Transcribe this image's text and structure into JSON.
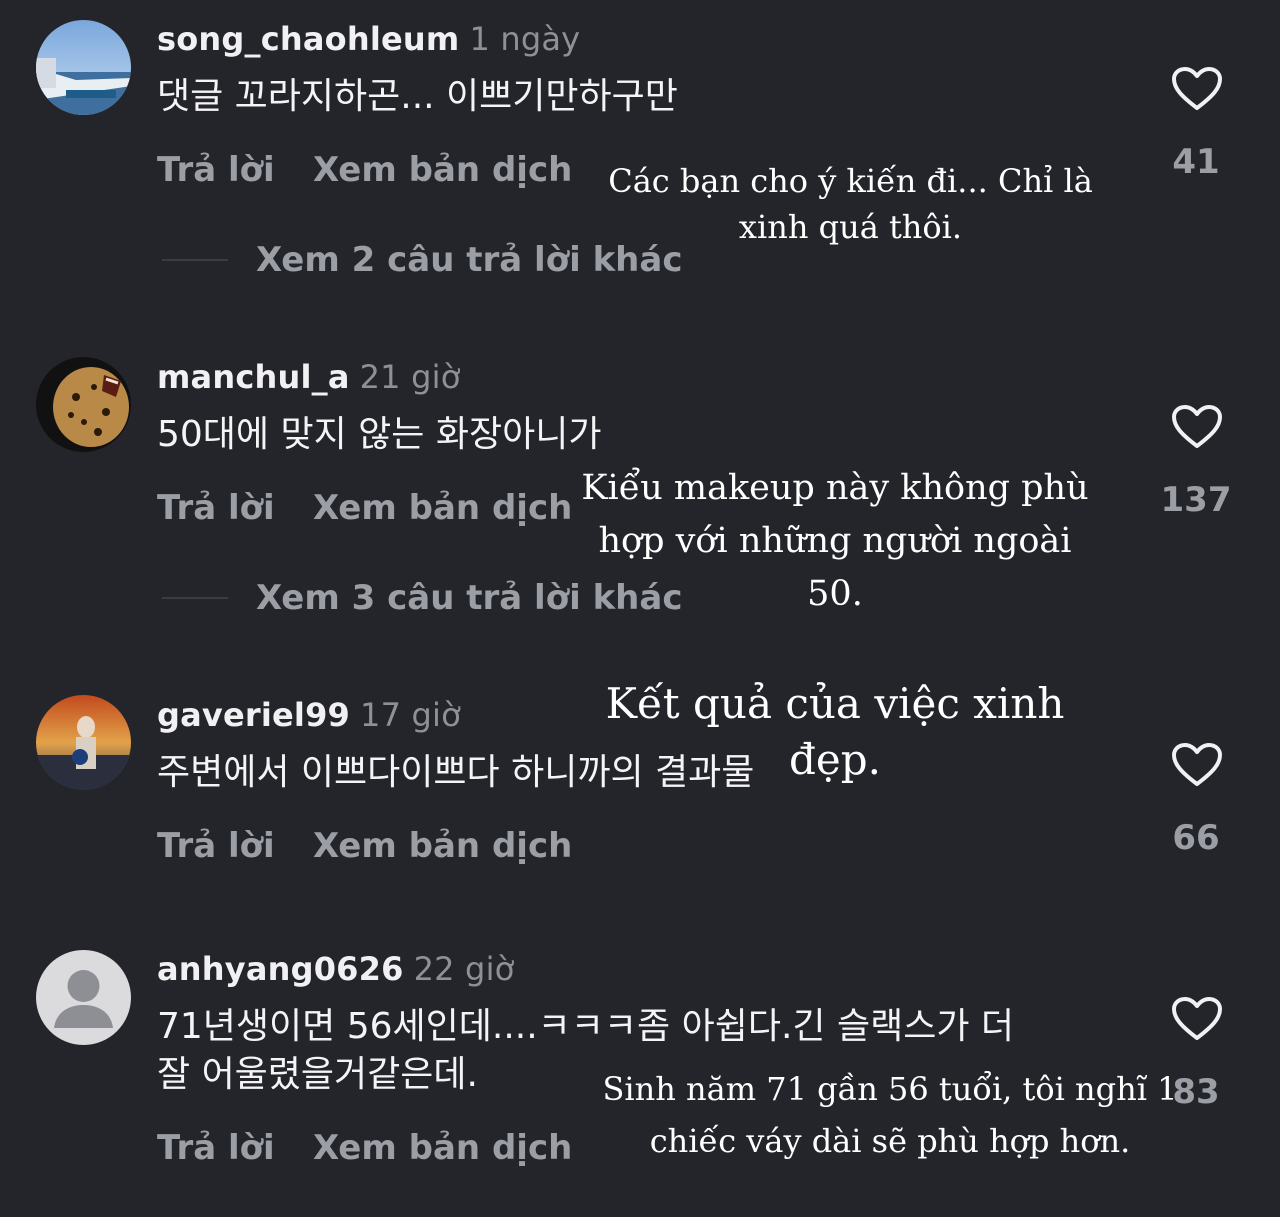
{
  "comments": [
    {
      "username": "song_chaohleum",
      "time": "1 ngày",
      "text": "댓글 꼬라지하곤... 이쁘기만하구만",
      "reply_label": "Trả lời",
      "translate_label": "Xem bản dịch",
      "more_replies": "Xem 2 câu trả lời khác",
      "likes": "41",
      "overlay": "Các bạn cho ý kiến đi... Chỉ là xinh quá thôi."
    },
    {
      "username": "manchul_a",
      "time": "21 giờ",
      "text": "50대에 맞지 않는 화장아니가",
      "reply_label": "Trả lời",
      "translate_label": "Xem bản dịch",
      "more_replies": "Xem 3 câu trả lời khác",
      "likes": "137",
      "overlay": "Kiểu makeup này không phù hợp với những người ngoài 50."
    },
    {
      "username": "gaveriel99",
      "time": "17 giờ",
      "text": "주변에서 이쁘다이쁘다 하니까의 결과물",
      "reply_label": "Trả lời",
      "translate_label": "Xem bản dịch",
      "likes": "66",
      "overlay": "Kết quả của việc xinh đẹp."
    },
    {
      "username": "anhyang0626",
      "time": "22 giờ",
      "text_line1": "71년생이면 56세인데....ㅋㅋㅋ좀 아쉽다.긴 슬랙스가 더",
      "text_line2": "잘 어울렸을거같은데.",
      "reply_label": "Trả lời",
      "translate_label": "Xem bản dịch",
      "likes": "83",
      "overlay": "Sinh năm 71 gần 56 tuổi, tôi nghĩ 1 chiếc váy dài sẽ phù hợp hơn."
    }
  ],
  "colors": {
    "background": "#23252b",
    "primary_text": "#f4f4f6",
    "secondary_text": "#9c9ea5"
  },
  "icons": {
    "like": "heart-outline-icon",
    "default_avatar": "person-silhouette-icon"
  }
}
